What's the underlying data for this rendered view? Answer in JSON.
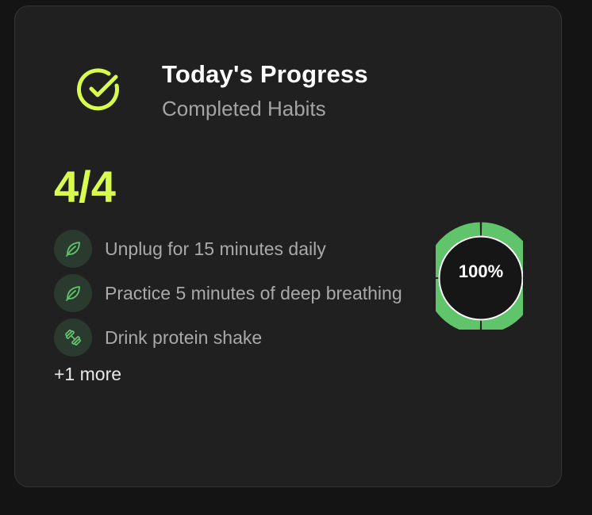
{
  "card": {
    "title": "Today's Progress",
    "subtitle": "Completed Habits",
    "header_icon": "check-circle-icon",
    "completed_count": "4/4",
    "habits": [
      {
        "label": "Unplug for 15 minutes daily",
        "icon": "leaf-icon"
      },
      {
        "label": "Practice 5 minutes of deep breathing",
        "icon": "leaf-icon"
      },
      {
        "label": "Drink protein shake",
        "icon": "dumbbell-icon"
      }
    ],
    "more_label": "+1 more",
    "progress": {
      "label": "100%",
      "fraction": 1.0,
      "segments": 4
    }
  },
  "colors": {
    "background": "#141414",
    "card": "#202020",
    "accent": "#d8fb4e",
    "ring": "#5fc46a",
    "habit_icon_bg": "#2b3a2f",
    "habit_icon": "#5fc46a"
  }
}
